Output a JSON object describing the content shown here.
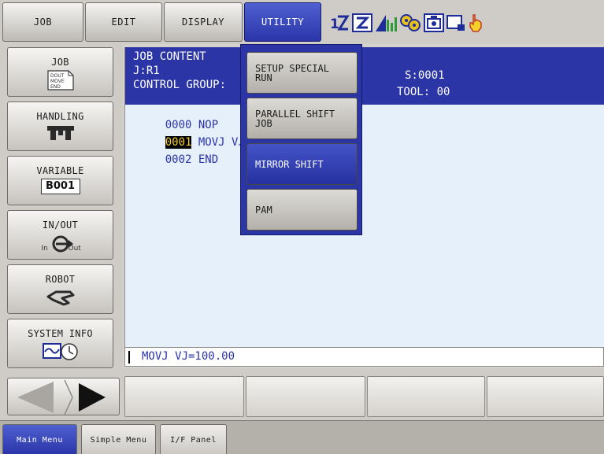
{
  "top_menu": {
    "job": "JOB",
    "edit": "EDIT",
    "display": "DISPLAY",
    "utility": "UTILITY"
  },
  "status_icons": [
    "coordinate-icon",
    "tool-select-icon",
    "signal-chart-icon",
    "gear-group-icon",
    "camera-icon",
    "keyboard-icon",
    "hand-icon"
  ],
  "main_menu": {
    "job": {
      "label": "JOB",
      "icon_text": "DOUT MOVE END"
    },
    "handling": {
      "label": "HANDLING"
    },
    "variable": {
      "label": "VARIABLE",
      "icon_text": "B001"
    },
    "inout": {
      "label": "IN/OUT",
      "icon_in": "In",
      "icon_out": "Out"
    },
    "robot": {
      "label": "ROBOT"
    },
    "system_info": {
      "label": "SYSTEM INFO"
    }
  },
  "job_content": {
    "title": "JOB CONTENT",
    "job_name": "J:R1",
    "control_group": "CONTROL GROUP:",
    "step": "S:0001",
    "tool": "TOOL: 00",
    "lines": [
      {
        "num": "0000",
        "instr": "NOP"
      },
      {
        "num": "0001",
        "instr": "MOVJ VJ=1"
      },
      {
        "num": "0002",
        "instr": "END"
      }
    ]
  },
  "input_line": "MOVJ VJ=100.00",
  "dropdown": {
    "items": [
      {
        "label": "SETUP SPECIAL\nRUN",
        "active": false
      },
      {
        "label": "PARALLEL SHIFT\nJOB",
        "active": false
      },
      {
        "label": "MIRROR SHIFT",
        "active": true
      },
      {
        "label": "PAM",
        "active": false
      }
    ]
  },
  "bottom_tabs": {
    "main_menu": "Main Menu",
    "simple_menu": "Simple Menu",
    "if_panel": "I/F Panel"
  },
  "colors": {
    "accent_blue": "#2b35a6",
    "content_bg": "#e6f0fb",
    "cursor_yellow": "#f5d12a"
  }
}
